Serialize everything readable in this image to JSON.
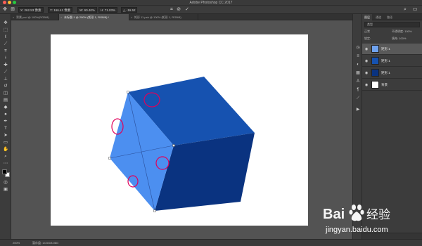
{
  "app": {
    "title": "Adobe Photoshop CC 2017"
  },
  "options_bar": {
    "x_value": "X: 262.53 像素",
    "y_value": "Y: 166.41 像素",
    "w_value": "W: 60.40%",
    "h_value": "H: 71.03%",
    "angle_value": "△ -16.52"
  },
  "tabs": [
    {
      "label": "背景.psd @ 100%(RGB/8)",
      "active": false
    },
    {
      "label": "未标题-1 @ 200% (矩形 1, RGB/8) *",
      "active": true
    },
    {
      "label": "矩形 11.psb @ 100% (矩形 1, RGB/8)",
      "active": false
    }
  ],
  "status_bar": {
    "zoom": "200%",
    "doc_info": "暂存盘: 14.5G/8.06G"
  },
  "layers_panel": {
    "tabs": [
      "图层",
      "通道",
      "路径"
    ],
    "filter_label": "类型",
    "blend_mode": "正常",
    "opacity_label": "不透明度: 100%",
    "lock_label": "锁定:",
    "fill_label": "填充: 100%",
    "layers": [
      {
        "name": "矩形 1",
        "selected": true
      },
      {
        "name": "矩形 1",
        "selected": false
      },
      {
        "name": "矩形 1",
        "selected": false
      },
      {
        "name": "背景",
        "selected": false
      }
    ]
  },
  "watermark": {
    "brand": "Bai 经验",
    "url": "jingyan.baidu.com"
  },
  "colors": {
    "cube_top": "#1652b0",
    "cube_right": "#0a3380",
    "cube_left": "#4c8ff0",
    "highlight": "#e0005a"
  }
}
